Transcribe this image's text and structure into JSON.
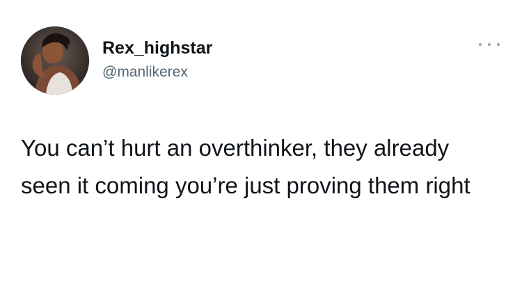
{
  "tweet": {
    "author": {
      "display_name": "Rex_highstar",
      "handle": "@manlikerex",
      "avatar_icon": "profile-photo"
    },
    "more_icon": "more-options-icon",
    "text": "You can’t hurt an overthinker, they already seen it coming you’re just proving them right"
  },
  "colors": {
    "background": "#ffffff",
    "text": "#0f1419",
    "secondary_text": "#536471"
  }
}
